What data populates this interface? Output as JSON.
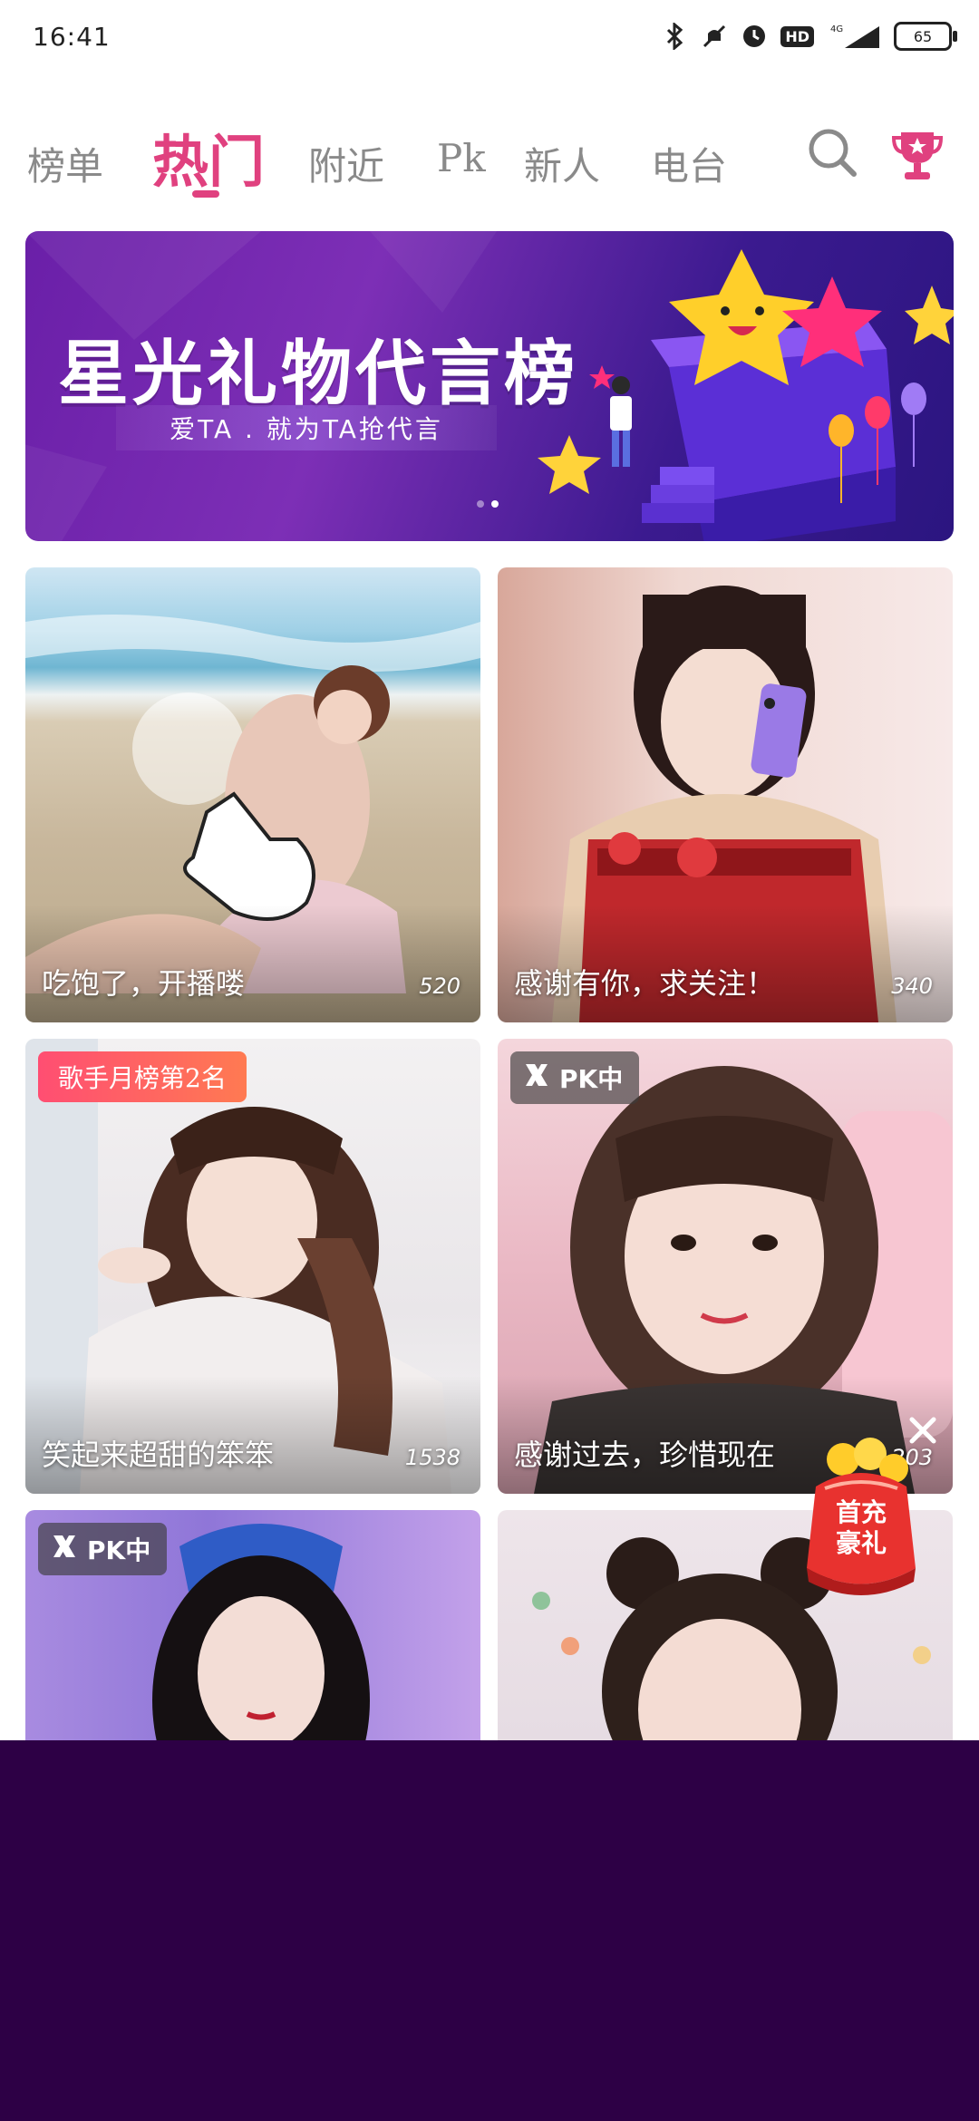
{
  "status_bar": {
    "time": "16:41",
    "network": "4G",
    "hd": "HD",
    "battery": "65"
  },
  "tabs": [
    {
      "label": "榜单",
      "active": false
    },
    {
      "label": "热门",
      "active": true
    },
    {
      "label": "附近",
      "active": false
    },
    {
      "label": "Pk",
      "active": false
    },
    {
      "label": "新人",
      "active": false
    },
    {
      "label": "电台",
      "active": false
    }
  ],
  "banner": {
    "title": "星光礼物代言榜",
    "subtitle": "爱TA . 就为TA抢代言"
  },
  "cards": [
    {
      "caption": "吃饱了，开播喽",
      "count": "520",
      "tag": ""
    },
    {
      "caption": "感谢有你，求关注！",
      "count": "340",
      "tag": ""
    },
    {
      "caption": "笑起来超甜的笨笨",
      "count": "1538",
      "tag": "歌手月榜第2名"
    },
    {
      "caption": "感谢过去，珍惜现在",
      "count": "203",
      "tag": "PK中"
    },
    {
      "caption": "",
      "count": "",
      "tag": "PK中"
    },
    {
      "caption": "",
      "count": "",
      "tag": ""
    }
  ],
  "gift": {
    "label_line1": "首充",
    "label_line2": "豪礼"
  },
  "colors": {
    "accent": "#e0417f",
    "bottom_bg": "#2d0045"
  }
}
